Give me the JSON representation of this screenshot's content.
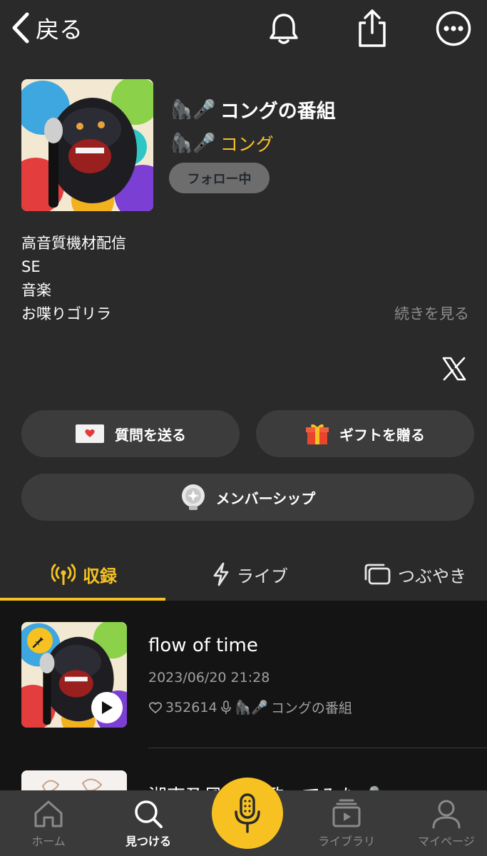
{
  "header": {
    "back_label": "戻る",
    "icons": [
      "chevron-left-icon",
      "bell-icon",
      "share-icon",
      "more-icon"
    ]
  },
  "program": {
    "title_emoji": "🦍🎤",
    "title": "コングの番組",
    "author_emoji": "🦍🎤",
    "author": "コング",
    "follow_label": "フォロー中",
    "description_lines": [
      "高音質機材配信",
      "SE",
      "音楽",
      "お喋りゴリラ"
    ],
    "more_label": "続きを見る"
  },
  "actions": {
    "question_label": "質問を送る",
    "gift_label": "ギフトを贈る",
    "membership_label": "メンバーシップ"
  },
  "tabs": [
    {
      "label": "収録",
      "icon": "broadcast-icon",
      "active": true
    },
    {
      "label": "ライブ",
      "icon": "bolt-icon",
      "active": false
    },
    {
      "label": "つぶやき",
      "icon": "cards-icon",
      "active": false
    }
  ],
  "episodes": [
    {
      "title": "flow of time",
      "date": "2023/06/20 21:28",
      "likes": "352614",
      "program_emoji": "🦍🎤",
      "program": "コングの番組",
      "pinned": true
    },
    {
      "title": "湘南乃風　歌 歌ってみた🎤"
    }
  ],
  "bottom_nav": [
    {
      "label": "ホーム",
      "icon": "home-icon",
      "active": false
    },
    {
      "label": "見つける",
      "icon": "search-icon",
      "active": true
    },
    {
      "label": "",
      "icon": "mic-icon",
      "active": false
    },
    {
      "label": "ライブラリ",
      "icon": "library-icon",
      "active": false
    },
    {
      "label": "マイページ",
      "icon": "person-icon",
      "active": false
    }
  ],
  "colors": {
    "accent": "#f7c221",
    "background": "#2a2a2a",
    "list_background": "#141414"
  }
}
